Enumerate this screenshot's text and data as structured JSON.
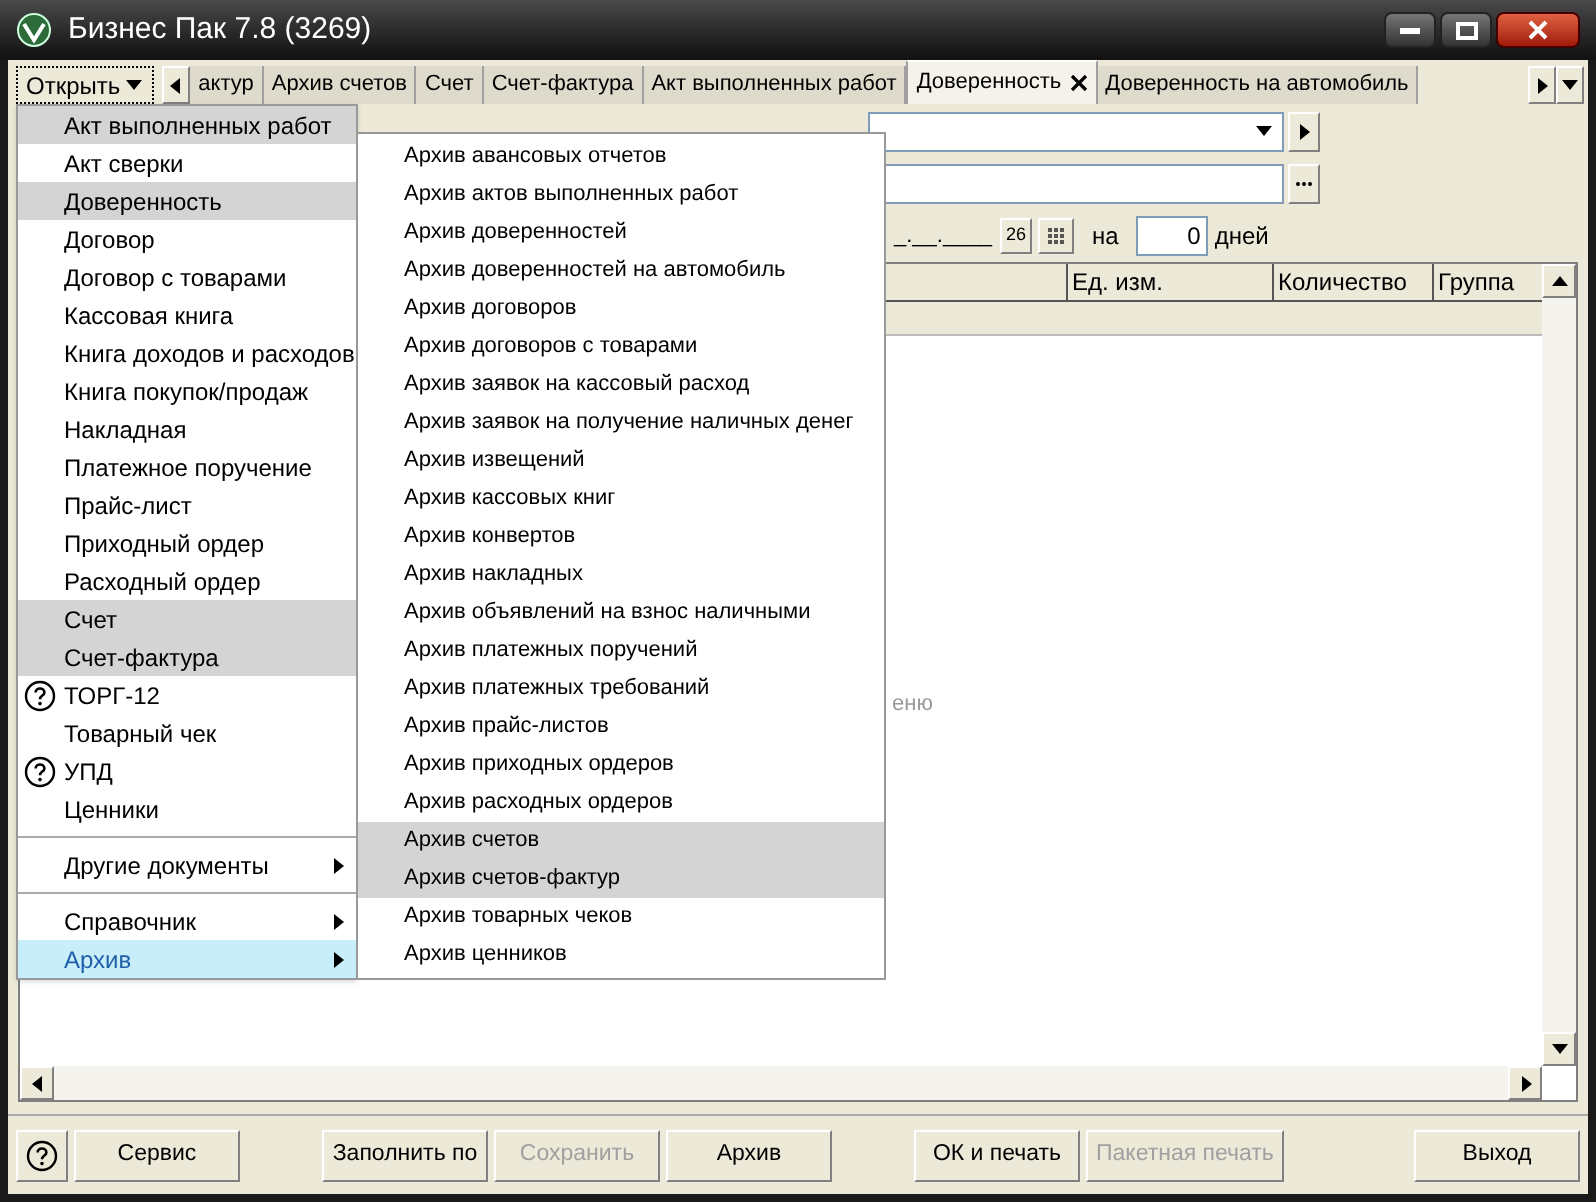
{
  "window": {
    "title": "Бизнес Пак 7.8 (3269)"
  },
  "open_button": {
    "label": "Открыть"
  },
  "tabs": [
    {
      "label": "актур",
      "selected": false
    },
    {
      "label": "Архив счетов",
      "selected": false
    },
    {
      "label": "Счет",
      "selected": false
    },
    {
      "label": "Счет-фактура",
      "selected": false
    },
    {
      "label": "Акт выполненных работ",
      "selected": false
    },
    {
      "label": "Доверенность",
      "selected": true
    },
    {
      "label": "Доверенность на автомобиль",
      "selected": false
    }
  ],
  "form": {
    "date_value": "_.__.____",
    "day_button": "26",
    "days_prefix": "на",
    "days_value": "0",
    "days_unit": "дней"
  },
  "table": {
    "columns": [
      "Ед. изм.",
      "Количество",
      "Группа"
    ],
    "hint_fragment": "еню"
  },
  "menu": {
    "groups": [
      [
        {
          "label": "Акт выполненных работ",
          "highlighted": true,
          "selected": false
        },
        {
          "label": "Акт сверки",
          "highlighted": false,
          "selected": false
        },
        {
          "label": "Доверенность",
          "highlighted": true,
          "selected": false
        },
        {
          "label": "Договор",
          "highlighted": false,
          "selected": false
        },
        {
          "label": "Договор с товарами",
          "highlighted": false,
          "selected": false
        },
        {
          "label": "Кассовая книга",
          "highlighted": false,
          "selected": false
        },
        {
          "label": "Книга доходов и расходов",
          "highlighted": false,
          "selected": false
        },
        {
          "label": "Книга покупок/продаж",
          "highlighted": false,
          "selected": false
        },
        {
          "label": "Накладная",
          "highlighted": false,
          "selected": false
        },
        {
          "label": "Платежное поручение",
          "highlighted": false,
          "selected": false
        },
        {
          "label": "Прайс-лист",
          "highlighted": false,
          "selected": false
        },
        {
          "label": "Приходный ордер",
          "highlighted": false,
          "selected": false
        },
        {
          "label": "Расходный ордер",
          "highlighted": false,
          "selected": false
        },
        {
          "label": "Счет",
          "highlighted": true,
          "selected": false
        },
        {
          "label": "Счет-фактура",
          "highlighted": true,
          "selected": false
        },
        {
          "label": "ТОРГ-12",
          "highlighted": false,
          "selected": false,
          "kind": "help"
        },
        {
          "label": "Товарный чек",
          "highlighted": false,
          "selected": false
        },
        {
          "label": "УПД",
          "highlighted": false,
          "selected": false,
          "kind": "help"
        },
        {
          "label": "Ценники",
          "highlighted": false,
          "selected": false
        }
      ],
      [
        {
          "label": "Другие документы",
          "highlighted": false,
          "selected": false,
          "submenu": true
        }
      ],
      [
        {
          "label": "Справочник",
          "highlighted": false,
          "selected": false,
          "submenu": true
        },
        {
          "label": "Архив",
          "highlighted": false,
          "selected": true,
          "submenu": true
        }
      ]
    ]
  },
  "submenu": [
    {
      "label": "Архив авансовых отчетов",
      "highlighted": false
    },
    {
      "label": "Архив актов выполненных работ",
      "highlighted": false
    },
    {
      "label": "Архив доверенностей",
      "highlighted": false
    },
    {
      "label": "Архив доверенностей на автомобиль",
      "highlighted": false
    },
    {
      "label": "Архив договоров",
      "highlighted": false
    },
    {
      "label": "Архив договоров с товарами",
      "highlighted": false
    },
    {
      "label": "Архив заявок на кассовый расход",
      "highlighted": false
    },
    {
      "label": "Архив заявок на получение наличных денег",
      "highlighted": false
    },
    {
      "label": "Архив извещений",
      "highlighted": false
    },
    {
      "label": "Архив кассовых книг",
      "highlighted": false
    },
    {
      "label": "Архив конвертов",
      "highlighted": false
    },
    {
      "label": "Архив накладных",
      "highlighted": false
    },
    {
      "label": "Архив объявлений на взнос наличными",
      "highlighted": false
    },
    {
      "label": "Архив платежных поручений",
      "highlighted": false
    },
    {
      "label": "Архив платежных требований",
      "highlighted": false
    },
    {
      "label": "Архив прайс-листов",
      "highlighted": false
    },
    {
      "label": "Архив приходных ордеров",
      "highlighted": false
    },
    {
      "label": "Архив расходных ордеров",
      "highlighted": false
    },
    {
      "label": "Архив счетов",
      "highlighted": true
    },
    {
      "label": "Архив счетов-фактур",
      "highlighted": true
    },
    {
      "label": "Архив товарных чеков",
      "highlighted": false
    },
    {
      "label": "Архив ценников",
      "highlighted": false
    }
  ],
  "buttons": [
    {
      "kind": "help",
      "disabled": false
    },
    {
      "kind": "normal",
      "label": "Сервис",
      "disabled": false
    },
    {
      "kind": "gap"
    },
    {
      "kind": "normal",
      "label": "Заполнить по",
      "disabled": false
    },
    {
      "kind": "normal",
      "label": "Сохранить",
      "disabled": true
    },
    {
      "kind": "normal",
      "label": "Архив",
      "disabled": false
    },
    {
      "kind": "gap"
    },
    {
      "kind": "normal",
      "label": "ОК и печать",
      "disabled": false
    },
    {
      "kind": "normal",
      "label": "Пакетная печать",
      "disabled": true
    },
    {
      "kind": "gap"
    },
    {
      "kind": "normal",
      "label": "Выход",
      "disabled": false
    }
  ]
}
